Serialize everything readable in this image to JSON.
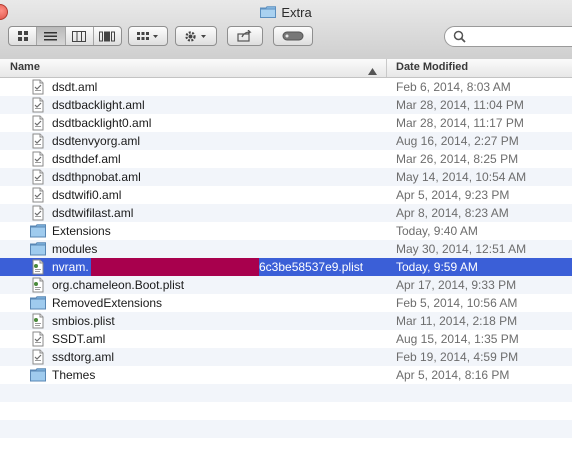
{
  "window": {
    "title": "Extra"
  },
  "toolbar": {
    "view_buttons": [
      "icon-view-icon",
      "list-view-icon",
      "column-view-icon",
      "coverflow-view-icon"
    ],
    "arrange": "arrange-icon",
    "action": "gear-icon",
    "share": "share-icon",
    "tags": "tags-icon",
    "search": {
      "placeholder": ""
    }
  },
  "columns": {
    "name": "Name",
    "date": "Date Modified"
  },
  "rows": [
    {
      "name": "dsdt.aml",
      "date": "Feb 6, 2014, 8:03 AM",
      "kind": "file"
    },
    {
      "name": "dsdtbacklight.aml",
      "date": "Mar 28, 2014, 11:04 PM",
      "kind": "file"
    },
    {
      "name": "dsdtbacklight0.aml",
      "date": "Mar 28, 2014, 11:17 PM",
      "kind": "file"
    },
    {
      "name": "dsdtenvyorg.aml",
      "date": "Aug 16, 2014, 2:27 PM",
      "kind": "file"
    },
    {
      "name": "dsdthdef.aml",
      "date": "Mar 26, 2014, 8:25 PM",
      "kind": "file"
    },
    {
      "name": "dsdthpnobat.aml",
      "date": "May 14, 2014, 10:54 AM",
      "kind": "file"
    },
    {
      "name": "dsdtwifi0.aml",
      "date": "Apr 5, 2014, 9:23 PM",
      "kind": "file"
    },
    {
      "name": "dsdtwifilast.aml",
      "date": "Apr 8, 2014, 8:23 AM",
      "kind": "file"
    },
    {
      "name": "Extensions",
      "date": "Today, 9:40 AM",
      "kind": "folder"
    },
    {
      "name": "modules",
      "date": "May 30, 2014, 12:51 AM",
      "kind": "folder"
    },
    {
      "name": "nvram.",
      "name_suffix": "6c3be58537e9.plist",
      "date": "Today, 9:59 AM",
      "kind": "plist",
      "selected": true
    },
    {
      "name": "org.chameleon.Boot.plist",
      "date": "Apr 17, 2014, 9:33 PM",
      "kind": "plist"
    },
    {
      "name": "RemovedExtensions",
      "date": "Feb 5, 2014, 10:56 AM",
      "kind": "folder"
    },
    {
      "name": "smbios.plist",
      "date": "Mar 11, 2014, 2:18 PM",
      "kind": "plist"
    },
    {
      "name": "SSDT.aml",
      "date": "Aug 15, 2014, 1:35 PM",
      "kind": "file"
    },
    {
      "name": "ssdtorg.aml",
      "date": "Feb 19, 2014, 4:59 PM",
      "kind": "file"
    },
    {
      "name": "Themes",
      "date": "Apr 5, 2014, 8:16 PM",
      "kind": "folder"
    }
  ],
  "colors": {
    "selection": "#3b5fd7",
    "redaction": "#a8004d",
    "date_text": "#6d6d6d"
  }
}
